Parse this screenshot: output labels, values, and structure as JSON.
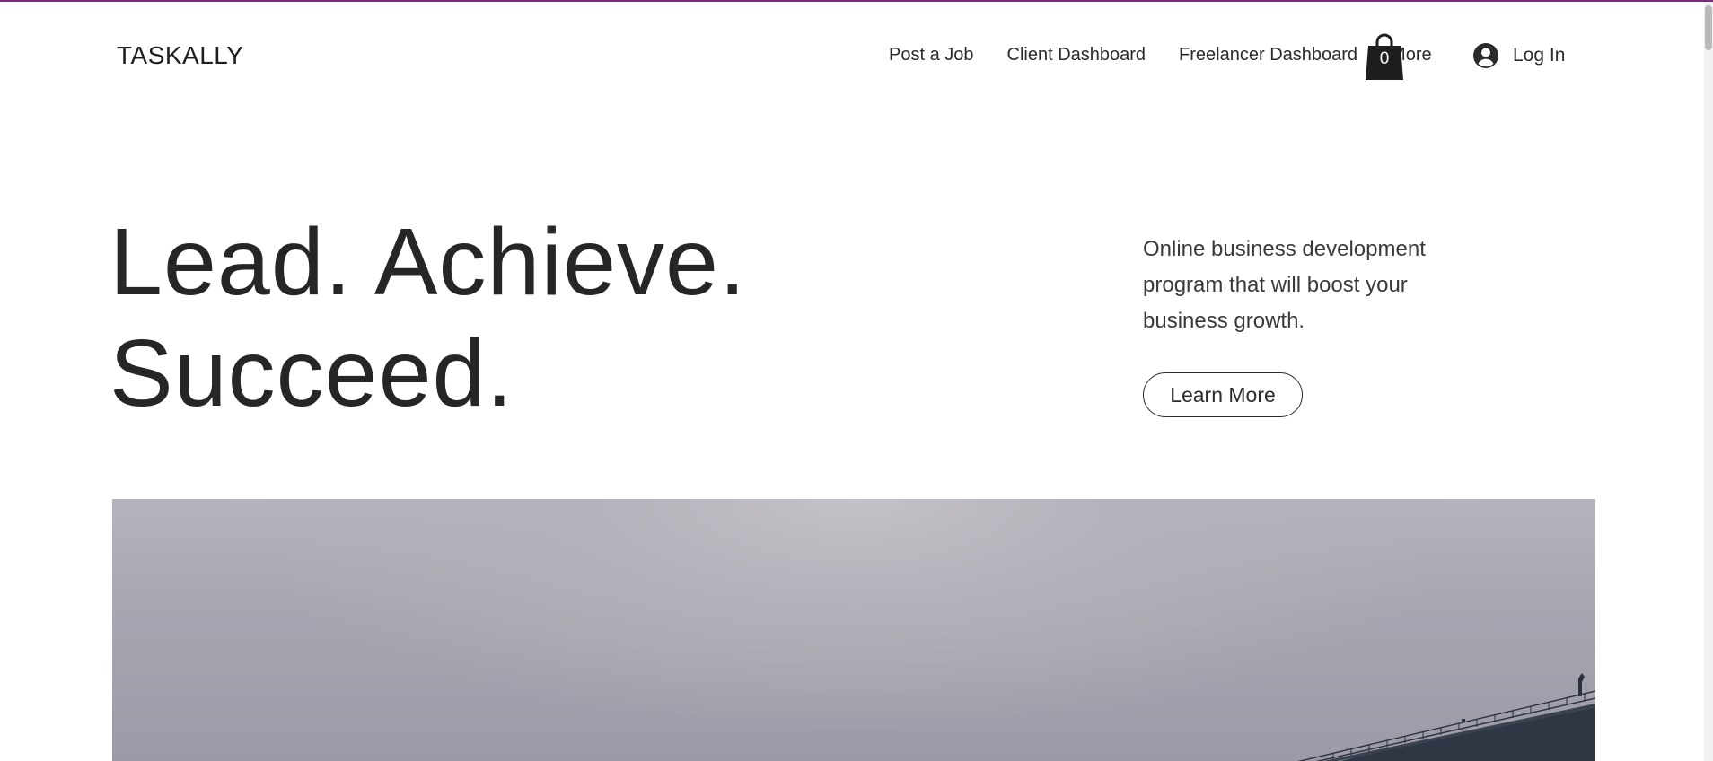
{
  "header": {
    "logo": "TASKALLY",
    "nav": [
      {
        "label": "Post a Job"
      },
      {
        "label": "Client Dashboard"
      },
      {
        "label": "Freelancer Dashboard"
      },
      {
        "label": "More"
      }
    ],
    "cart": {
      "count": "0",
      "icon": "shopping-bag-icon"
    },
    "login": {
      "label": "Log In",
      "icon": "user-avatar-icon"
    }
  },
  "hero": {
    "title_line1": "Lead. Achieve.",
    "title_line2": "Succeed.",
    "description": "Online business development program that will boost your business growth.",
    "cta_label": "Learn More"
  },
  "image": {
    "subject": "foggy-sky-with-bridge-photo"
  },
  "colors": {
    "top_border": "#7a2a7a",
    "text": "#222222",
    "cart": "#1e1e1e",
    "image_sky": "#a6a5b0"
  }
}
